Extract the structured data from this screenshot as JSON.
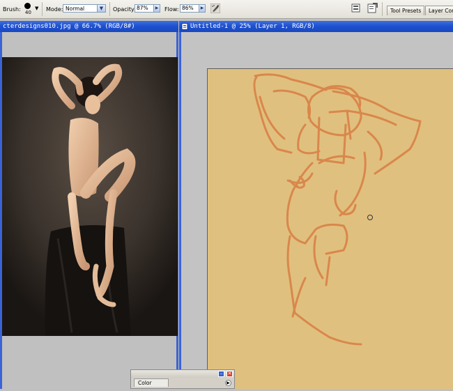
{
  "options_bar": {
    "brush_label": "Brush:",
    "brush_size": "40",
    "mode_label": "Mode:",
    "mode_value": "Normal",
    "opacity_label": "Opacity:",
    "opacity_value": "87%",
    "flow_label": "Flow:",
    "flow_value": "86%",
    "tool_presets_tab": "Tool Presets",
    "layer_comps_tab": "Layer Com"
  },
  "documents": [
    {
      "title": "cterdesigns010.jpg @ 66.7% (RGB/8#)"
    },
    {
      "title": "Untitled-1 @ 25% (Layer 1, RGB/8)"
    }
  ],
  "color_palette": {
    "tab_label": "Color"
  },
  "colors": {
    "title_bar": "#1d4fcf",
    "canvas_fill": "#e0c07f",
    "sketch_stroke": "#d98a4e"
  }
}
